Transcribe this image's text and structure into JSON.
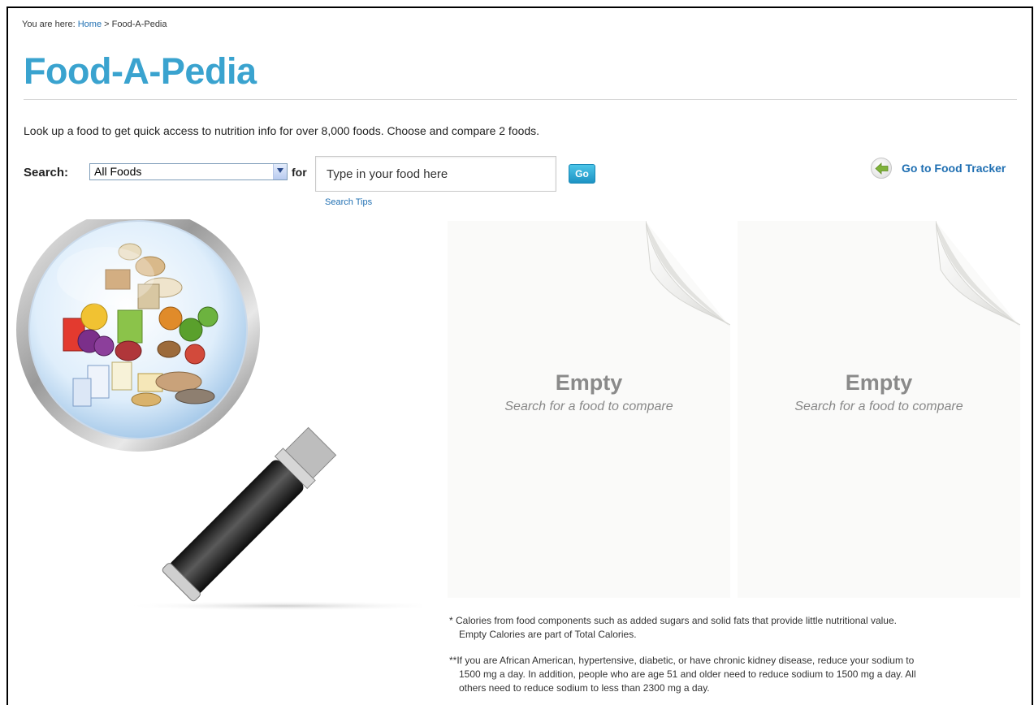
{
  "breadcrumb": {
    "prefix": "You are here:",
    "home": "Home",
    "separator": ">",
    "current": "Food-A-Pedia"
  },
  "page": {
    "title": "Food-A-Pedia",
    "intro": "Look up a food to get quick access to nutrition info for over 8,000 foods. Choose and compare 2 foods."
  },
  "search": {
    "label": "Search:",
    "category_selected": "All Foods",
    "for_label": "for",
    "placeholder": "Type in your food here",
    "go_label": "Go",
    "tips_label": "Search Tips"
  },
  "tracker": {
    "label": "Go to Food Tracker",
    "icon": "arrow-left-icon"
  },
  "compare": {
    "cards": [
      {
        "title": "Empty",
        "subtitle": "Search for a food to compare"
      },
      {
        "title": "Empty",
        "subtitle": "Search for a food to compare"
      }
    ]
  },
  "footnotes": {
    "empty_calories_line1": "* Calories from food components such as added sugars and solid fats that provide little nutritional value.",
    "empty_calories_line2": "Empty Calories are part of Total Calories.",
    "sodium_line1": "**If you are African American, hypertensive, diabetic, or have chronic kidney disease, reduce your sodium to",
    "sodium_line2": "1500 mg a day. In addition, people who are age 51 and older need to reduce sodium to 1500 mg a day. All",
    "sodium_line3": "others need to reduce sodium to less than 2300 mg a day."
  },
  "colors": {
    "title": "#3aa3cf",
    "link": "#1f6fb2",
    "go_button": "#1d93c4",
    "tracker_arrow": "#7fb23a"
  }
}
